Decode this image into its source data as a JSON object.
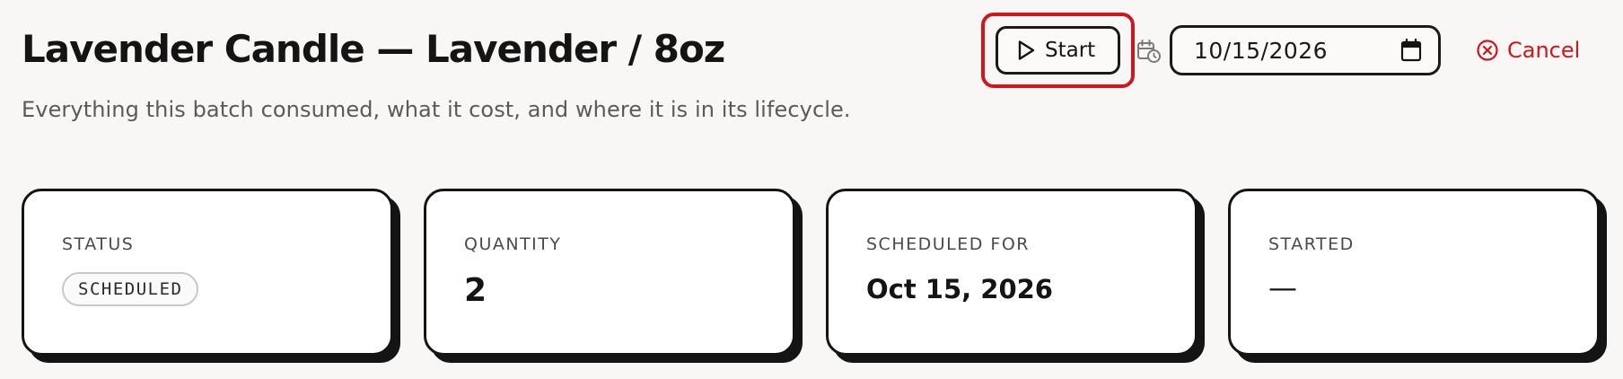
{
  "header": {
    "title": "Lavender Candle — Lavender / 8oz",
    "subtitle": "Everything this batch consumed, what it cost, and where it is in its lifecycle."
  },
  "actions": {
    "start_label": "Start",
    "start_icon": "play-icon",
    "schedule_icon": "calendar-clock-icon",
    "date_value": "10/15/2026",
    "date_icon": "calendar-icon",
    "cancel_label": "Cancel",
    "cancel_icon": "x-circle-icon",
    "accent_color": "#d0161d"
  },
  "cards": [
    {
      "label": "STATUS",
      "badge": "SCHEDULED"
    },
    {
      "label": "QUANTITY",
      "value": "2"
    },
    {
      "label": "SCHEDULED FOR",
      "value": "Oct 15, 2026"
    },
    {
      "label": "STARTED",
      "value": "—"
    }
  ]
}
